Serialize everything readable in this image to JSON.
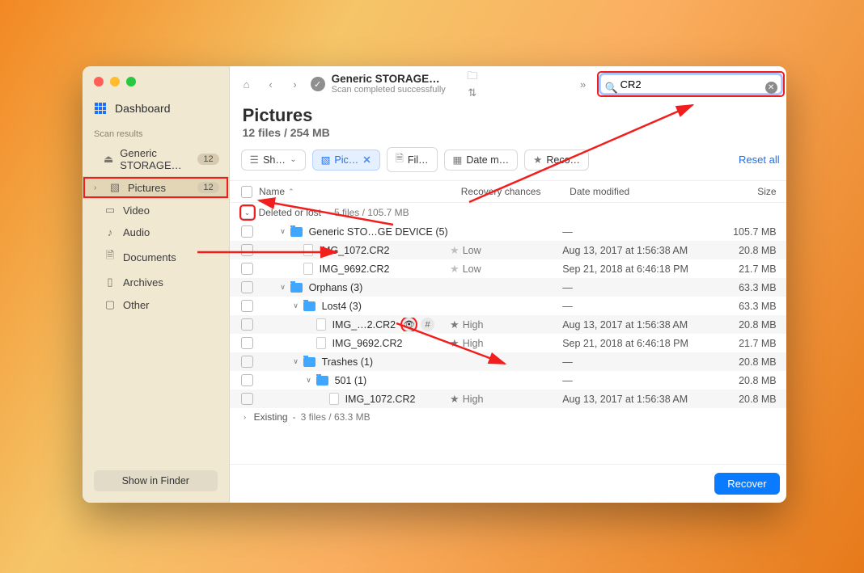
{
  "sidebar": {
    "dashboard": "Dashboard",
    "section_label": "Scan results",
    "storage": {
      "label": "Generic STORAGE…",
      "badge": "12"
    },
    "pictures": {
      "label": "Pictures",
      "badge": "12"
    },
    "video": "Video",
    "audio": "Audio",
    "documents": "Documents",
    "archives": "Archives",
    "other": "Other",
    "finder_btn": "Show in Finder"
  },
  "toolbar": {
    "title": "Generic STORAGE…",
    "subtitle": "Scan completed successfully",
    "search_value": "CR2"
  },
  "heading": {
    "title": "Pictures",
    "subtitle": "12 files / 254 MB"
  },
  "filters": {
    "show": "Sh…",
    "pic": "Pic…",
    "file": "Fil…",
    "date": "Date m…",
    "reco": "Reco…",
    "reset": "Reset all"
  },
  "columns": {
    "name": "Name",
    "rec": "Recovery chances",
    "date": "Date modified",
    "size": "Size"
  },
  "group_deleted": {
    "name": "Deleted or lost",
    "meta": "5 files / 105.7 MB"
  },
  "group_existing": {
    "name": "Existing",
    "meta": "3 files / 63.3 MB"
  },
  "rows": [
    {
      "name": "Generic STO…GE DEVICE (5)",
      "type": "folder",
      "indent": 1,
      "chev": "∨",
      "rec": "",
      "date": "—",
      "size": "105.7 MB",
      "alt": false
    },
    {
      "name": "IMG_1072.CR2",
      "type": "file",
      "indent": 2,
      "chev": "",
      "rec": "Low",
      "star": "low",
      "date": "Aug 13, 2017 at 1:56:38 AM",
      "size": "20.8 MB",
      "alt": true
    },
    {
      "name": "IMG_9692.CR2",
      "type": "file",
      "indent": 2,
      "chev": "",
      "rec": "Low",
      "star": "low",
      "date": "Sep 21, 2018 at 6:46:18 PM",
      "size": "21.7 MB",
      "alt": false
    },
    {
      "name": "Orphans (3)",
      "type": "folder",
      "indent": 1,
      "chev": "∨",
      "rec": "",
      "date": "—",
      "size": "63.3 MB",
      "alt": true
    },
    {
      "name": "Lost4 (3)",
      "type": "folder",
      "indent": 2,
      "chev": "∨",
      "rec": "",
      "date": "—",
      "size": "63.3 MB",
      "alt": false
    },
    {
      "name": "IMG_…2.CR2",
      "type": "file",
      "indent": 3,
      "chev": "",
      "rec": "High",
      "star": "high",
      "date": "Aug 13, 2017 at 1:56:38 AM",
      "size": "20.8 MB",
      "alt": true,
      "eye": true
    },
    {
      "name": "IMG_9692.CR2",
      "type": "file",
      "indent": 3,
      "chev": "",
      "rec": "High",
      "star": "high",
      "date": "Sep 21, 2018 at 6:46:18 PM",
      "size": "21.7 MB",
      "alt": false
    },
    {
      "name": "Trashes (1)",
      "type": "folder",
      "indent": 2,
      "chev": "∨",
      "rec": "",
      "date": "—",
      "size": "20.8 MB",
      "alt": true
    },
    {
      "name": "501 (1)",
      "type": "folder",
      "indent": 3,
      "chev": "∨",
      "rec": "",
      "date": "—",
      "size": "20.8 MB",
      "alt": false
    },
    {
      "name": "IMG_1072.CR2",
      "type": "file",
      "indent": 4,
      "chev": "",
      "rec": "High",
      "star": "high",
      "date": "Aug 13, 2017 at 1:56:38 AM",
      "size": "20.8 MB",
      "alt": true
    }
  ],
  "footer": {
    "recover": "Recover"
  }
}
